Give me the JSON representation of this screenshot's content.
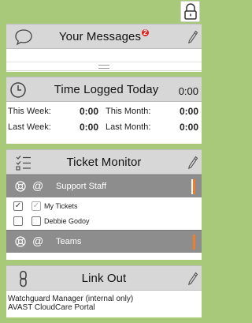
{
  "lock": {
    "icon": "padlock-icon"
  },
  "messages": {
    "title": "Your Messages",
    "badge": "2",
    "icon": "speech-bubble-icon"
  },
  "time": {
    "title": "Time Logged Today",
    "today": "0:00",
    "rows": [
      {
        "l1": "This Week:",
        "v1": "0:00",
        "l2": "This Month:",
        "v2": "0:00"
      },
      {
        "l1": "Last Week:",
        "v1": "0:00",
        "l2": "Last Month:",
        "v2": "0:00"
      }
    ]
  },
  "ticket": {
    "title": "Ticket Monitor",
    "group1": "Support Staff",
    "items": [
      {
        "label": "My Tickets",
        "checked": true
      },
      {
        "label": "Debbie Godoy",
        "checked": false
      }
    ],
    "group2": "Teams",
    "accent": "#f07d2a"
  },
  "link": {
    "title": "Link Out",
    "items": [
      "Watchguard Manager (internal only)",
      "AVAST CloudCare Portal"
    ]
  }
}
